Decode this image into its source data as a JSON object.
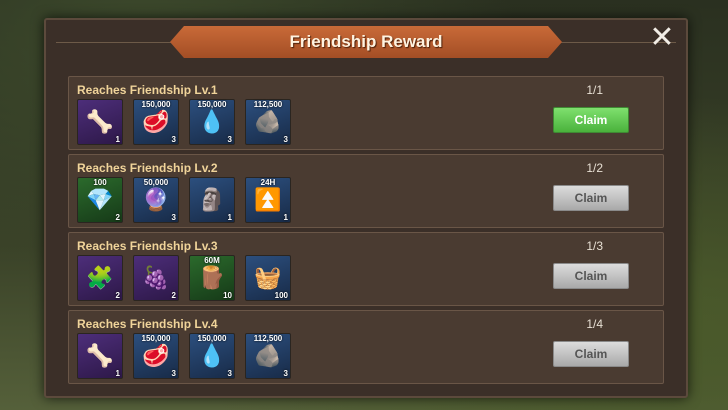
{
  "title": "Friendship Reward",
  "close_symbol": "✕",
  "rows": [
    {
      "title": "Reaches Friendship Lv.1",
      "progress": "1/1",
      "claim": "Claim",
      "claim_state": "active",
      "items": [
        {
          "icon": "horn-icon",
          "glyph": "🦴",
          "top": "",
          "qty": "1",
          "bg": "purple"
        },
        {
          "icon": "meat-icon",
          "glyph": "🥩",
          "top": "150,000",
          "qty": "3",
          "bg": "blue"
        },
        {
          "icon": "water-drop-icon",
          "glyph": "💧",
          "top": "150,000",
          "qty": "3",
          "bg": "blue"
        },
        {
          "icon": "stone-icon",
          "glyph": "🪨",
          "top": "112,500",
          "qty": "3",
          "bg": "blue"
        }
      ]
    },
    {
      "title": "Reaches Friendship Lv.2",
      "progress": "1/2",
      "claim": "Claim",
      "claim_state": "disabled",
      "items": [
        {
          "icon": "ruby-icon",
          "glyph": "💎",
          "top": "100",
          "qty": "2",
          "bg": "green"
        },
        {
          "icon": "crystal-icon",
          "glyph": "🔮",
          "top": "50,000",
          "qty": "3",
          "bg": "blue"
        },
        {
          "icon": "goblin-statue-icon",
          "glyph": "🗿",
          "top": "",
          "qty": "1",
          "bg": "blue"
        },
        {
          "icon": "speedup-icon",
          "glyph": "⏫",
          "top": "24H",
          "qty": "1",
          "bg": "blue"
        }
      ]
    },
    {
      "title": "Reaches Friendship Lv.3",
      "progress": "1/3",
      "claim": "Claim",
      "claim_state": "disabled",
      "items": [
        {
          "icon": "puzzle-icon",
          "glyph": "🧩",
          "top": "",
          "qty": "2",
          "bg": "purple"
        },
        {
          "icon": "berry-icon",
          "glyph": "🍇",
          "top": "",
          "qty": "2",
          "bg": "purple"
        },
        {
          "icon": "wood-arrow-icon",
          "glyph": "🪵",
          "top": "60M",
          "qty": "10",
          "bg": "green"
        },
        {
          "icon": "food-basket-icon",
          "glyph": "🧺",
          "top": "",
          "qty": "100",
          "bg": "blue"
        }
      ]
    },
    {
      "title": "Reaches Friendship Lv.4",
      "progress": "1/4",
      "claim": "Claim",
      "claim_state": "disabled",
      "items": [
        {
          "icon": "horn-icon",
          "glyph": "🦴",
          "top": "",
          "qty": "1",
          "bg": "purple"
        },
        {
          "icon": "meat-icon",
          "glyph": "🥩",
          "top": "150,000",
          "qty": "3",
          "bg": "blue"
        },
        {
          "icon": "water-drop-icon",
          "glyph": "💧",
          "top": "150,000",
          "qty": "3",
          "bg": "blue"
        },
        {
          "icon": "stone-icon",
          "glyph": "🪨",
          "top": "112,500",
          "qty": "3",
          "bg": "blue"
        }
      ]
    }
  ]
}
